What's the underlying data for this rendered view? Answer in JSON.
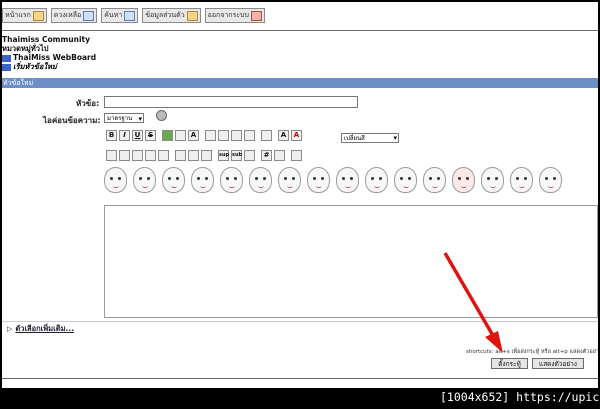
{
  "nav": {
    "items": [
      {
        "label": "หน้าแรก",
        "icon": "home-icon"
      },
      {
        "label": "ดวงเหลือ",
        "icon": "help-icon"
      },
      {
        "label": "ค้นหา",
        "icon": "search-icon"
      },
      {
        "label": "ข้อมูลส่วนตัว",
        "icon": "profile-icon"
      },
      {
        "label": "ออกจากระบบ",
        "icon": "logout-icon"
      }
    ]
  },
  "breadcrumb": {
    "community": "Thaimiss Community",
    "category": "หมวดหมู่ทั่วไป",
    "board": "ThaiMiss WebBoard",
    "action": "เริ่มหัวข้อใหม่"
  },
  "section_title": "หัวข้อใหม่",
  "form": {
    "subject_label": "หัวข้อ:",
    "icon_label": "ไอค่อนข้อความ:",
    "icon_select_value": "มาตรฐาน",
    "color_select_value": "เปลี่ยนสี"
  },
  "toolbar_rows": {
    "row1": [
      "B",
      "I",
      "U",
      "S",
      "",
      "",
      "A",
      "",
      "",
      "",
      "",
      "",
      "A",
      "A"
    ],
    "row2": [
      "",
      "",
      "",
      "",
      "",
      "",
      "",
      "",
      "sup",
      "sub",
      "",
      "#",
      "",
      ""
    ]
  },
  "more_options": "ตัวเลือกเพิ่มเติม...",
  "shortcut_hint": "shortcuts: alt+s เพื่อส่งกระทู้ หรือ alt+p แสดงตัวอย่าง",
  "buttons": {
    "post": "ตั้งกระทู้",
    "preview": "แสดงตัวอย่าง"
  },
  "caption": "[1004x652] https://upic.me/",
  "colors": {
    "titlebar": "#6d8fc7",
    "arrow": "#e0140f"
  }
}
